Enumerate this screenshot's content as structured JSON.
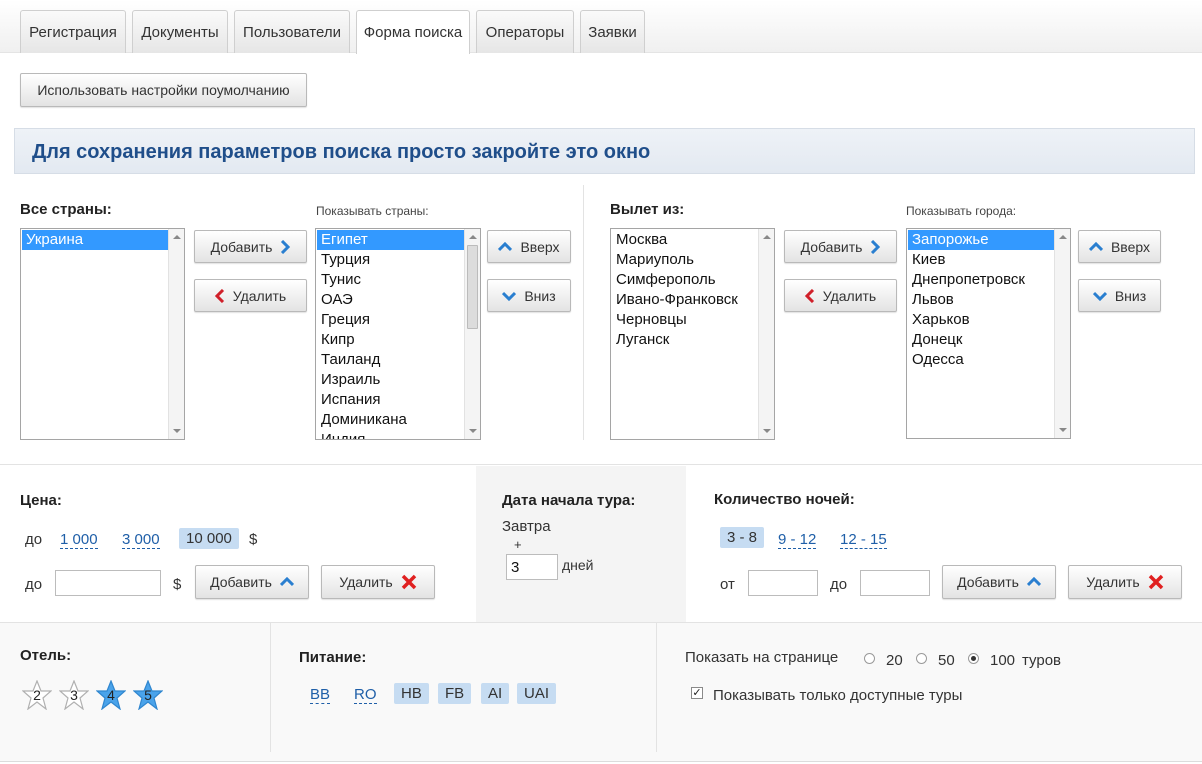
{
  "tabs": [
    "Регистрация",
    "Документы",
    "Пользователи",
    "Форма поиска",
    "Операторы",
    "Заявки"
  ],
  "active_tab": "Форма поиска",
  "default_button": "Использовать настройки поумолчанию",
  "banner": "Для сохранения параметров поиска просто закройте это окно",
  "countries": {
    "all_label": "Все страны:",
    "all": [
      "Украина"
    ],
    "shown_label": "Показывать страны:",
    "shown": [
      "Египет",
      "Турция",
      "Тунис",
      "ОАЭ",
      "Греция",
      "Кипр",
      "Таиланд",
      "Израиль",
      "Испания",
      "Доминикана",
      "Индия"
    ],
    "add": "Добавить",
    "remove": "Удалить",
    "up": "Вверх",
    "down": "Вниз"
  },
  "departure": {
    "label": "Вылет из:",
    "all": [
      "Москва",
      "Мариуполь",
      "Симферополь",
      "Ивано-Франковск",
      "Черновцы",
      "Луганск"
    ],
    "shown_label": "Показывать города:",
    "shown": [
      "Запорожье",
      "Киев",
      "Днепропетровск",
      "Львов",
      "Харьков",
      "Донецк",
      "Одесса"
    ],
    "add": "Добавить",
    "remove": "Удалить",
    "up": "Вверх",
    "down": "Вниз"
  },
  "price": {
    "label": "Цена:",
    "to": "до",
    "options": [
      "1 000",
      "3 000",
      "10 000"
    ],
    "selected": "10 000",
    "currency": "$",
    "input_value": "",
    "add": "Добавить",
    "remove": "Удалить"
  },
  "date": {
    "label": "Дата начала тура:",
    "start": "Завтра",
    "plus": "+",
    "days_value": "3",
    "days_unit": "дней"
  },
  "nights": {
    "label": "Количество ночей:",
    "options": [
      "3 - 8",
      "9 - 12",
      "12 - 15"
    ],
    "selected": "3 - 8",
    "from": "от",
    "to": "до",
    "from_value": "",
    "to_value": "",
    "add": "Добавить",
    "remove": "Удалить"
  },
  "hotel": {
    "label": "Отель:",
    "stars": [
      "2",
      "3",
      "4",
      "5"
    ],
    "selected": [
      "4",
      "5"
    ]
  },
  "meals": {
    "label": "Питание:",
    "options": [
      "BB",
      "RO",
      "HB",
      "FB",
      "AI",
      "UAI"
    ],
    "selected": [
      "HB",
      "FB",
      "AI",
      "UAI"
    ]
  },
  "per_page": {
    "label": "Показать на странице",
    "options": [
      "20",
      "50",
      "100"
    ],
    "selected": "100",
    "suffix": "туров"
  },
  "only_available": {
    "label": "Показывать только доступные туры",
    "checked": true
  },
  "colors": {
    "accent": "#1f4e8a",
    "selection": "#3399ff",
    "chip": "#c6dcf2",
    "link": "#1f5fa8",
    "delete_x": "#e02020",
    "arrow_blue": "#2a7fd0",
    "arrow_red": "#d0202a",
    "star_blue": "#4aa3ea"
  }
}
